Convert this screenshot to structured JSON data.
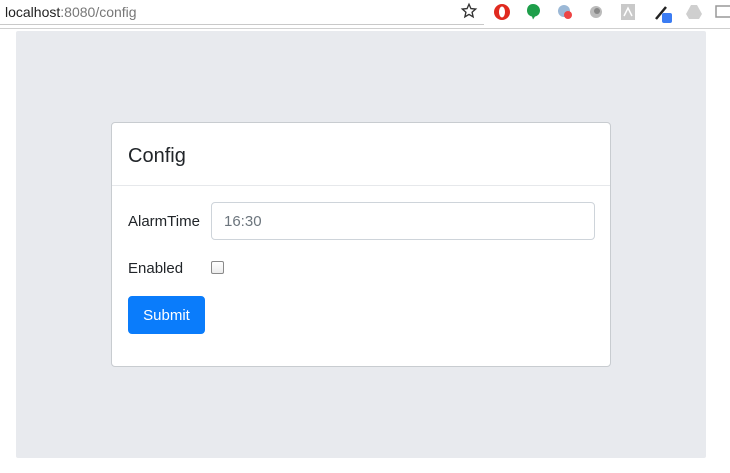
{
  "browser": {
    "url_host": "localhost",
    "url_rest_port": ":8080",
    "url_path": "/config",
    "extensions": [
      "opera-icon",
      "evernote-icon",
      "cloud-sync-icon",
      "circle-extension-icon",
      "pdf-icon",
      "color-picker-icon",
      "drive-icon",
      "cast-icon"
    ]
  },
  "card": {
    "title": "Config",
    "alarm_label": "AlarmTime",
    "alarm_value": "16:30",
    "enabled_label": "Enabled",
    "enabled_checked": false,
    "submit_label": "Submit"
  },
  "colors": {
    "accent": "#0a7cfb",
    "page_background": "#e8eaee"
  }
}
